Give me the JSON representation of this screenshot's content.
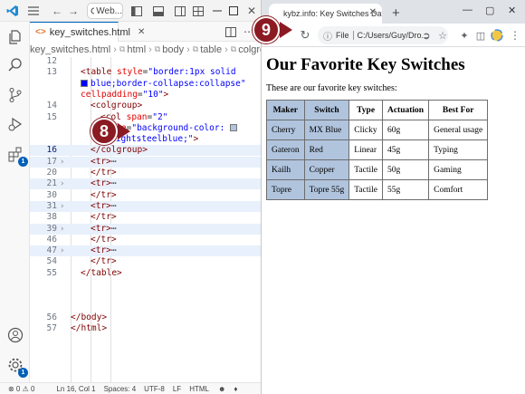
{
  "vscode": {
    "search_text": "Web...",
    "tab_filename": "key_switches.html",
    "breadcrumb": [
      "key_switches.html",
      "html",
      "body",
      "table",
      "colgroup"
    ],
    "lines": [
      {
        "num": "12",
        "parts": []
      },
      {
        "num": "13",
        "parts": [
          {
            "c": "tg",
            "t": "<table "
          },
          {
            "c": "at",
            "t": "style"
          },
          {
            "c": "pl",
            "t": "="
          },
          {
            "c": "vl",
            "t": "\"border:1px solid"
          }
        ]
      },
      {
        "num": "",
        "parts": [
          {
            "c": "vl",
            "t": "blue;border-collapse:collapse\""
          }
        ],
        "swatch": "#0000ff"
      },
      {
        "num": "",
        "parts": [
          {
            "c": "at",
            "t": "cellpadding"
          },
          {
            "c": "pl",
            "t": "="
          },
          {
            "c": "vl",
            "t": "\"10\""
          },
          {
            "c": "tg",
            "t": ">"
          }
        ]
      },
      {
        "num": "14",
        "parts": [
          {
            "c": "tg",
            "t": "<colgroup>"
          }
        ]
      },
      {
        "num": "15",
        "parts": [
          {
            "c": "tg",
            "t": "<col "
          },
          {
            "c": "at",
            "t": "span"
          },
          {
            "c": "pl",
            "t": "="
          },
          {
            "c": "vl",
            "t": "\"2\""
          }
        ]
      },
      {
        "num": "",
        "parts": [
          {
            "c": "at",
            "t": "style"
          },
          {
            "c": "pl",
            "t": "="
          },
          {
            "c": "vl",
            "t": "\"background-color:"
          }
        ],
        "swatch_end": "#b0c4de"
      },
      {
        "num": "",
        "parts": [
          {
            "c": "vl",
            "t": "lightsteelblue;\""
          },
          {
            "c": "tg",
            "t": ">"
          }
        ],
        "swatch": "#b0c4de"
      },
      {
        "num": "16",
        "parts": [
          {
            "c": "tg",
            "t": "</colgroup>"
          }
        ]
      },
      {
        "num": "17",
        "parts": [
          {
            "c": "tg",
            "t": "<tr>"
          },
          {
            "c": "pl",
            "t": "⋯"
          }
        ]
      },
      {
        "num": "20",
        "parts": [
          {
            "c": "tg",
            "t": "</tr>"
          }
        ]
      },
      {
        "num": "21",
        "parts": [
          {
            "c": "tg",
            "t": "<tr>"
          },
          {
            "c": "pl",
            "t": "⋯"
          }
        ]
      },
      {
        "num": "30",
        "parts": [
          {
            "c": "tg",
            "t": "</tr>"
          }
        ]
      },
      {
        "num": "31",
        "parts": [
          {
            "c": "tg",
            "t": "<tr>"
          },
          {
            "c": "pl",
            "t": "⋯"
          }
        ]
      },
      {
        "num": "38",
        "parts": [
          {
            "c": "tg",
            "t": "</tr>"
          }
        ]
      },
      {
        "num": "39",
        "parts": [
          {
            "c": "tg",
            "t": "<tr>"
          },
          {
            "c": "pl",
            "t": "⋯"
          }
        ]
      },
      {
        "num": "46",
        "parts": [
          {
            "c": "tg",
            "t": "</tr>"
          }
        ]
      },
      {
        "num": "47",
        "parts": [
          {
            "c": "tg",
            "t": "<tr>"
          },
          {
            "c": "pl",
            "t": "⋯"
          }
        ]
      },
      {
        "num": "54",
        "parts": [
          {
            "c": "tg",
            "t": "</tr>"
          }
        ]
      },
      {
        "num": "55",
        "parts": [
          {
            "c": "tg",
            "t": "</table>"
          }
        ]
      },
      {
        "num": "",
        "parts": []
      },
      {
        "num": "",
        "parts": []
      },
      {
        "num": "",
        "parts": []
      },
      {
        "num": "56",
        "parts": [
          {
            "c": "tg",
            "t": "</body>"
          }
        ]
      },
      {
        "num": "57",
        "parts": [
          {
            "c": "tg",
            "t": "</html>"
          }
        ]
      }
    ],
    "status": {
      "problems": "⊗ 0 ⚠ 0",
      "position": "Ln 16, Col 1",
      "spaces": "Spaces: 4",
      "encoding": "UTF-8",
      "eol": "LF",
      "language": "HTML"
    },
    "badge_count": "1",
    "accounts_badge": "1"
  },
  "chrome": {
    "tab_title": "kybz.info: Key Switches Data",
    "url_prefix": "File",
    "url": "C:/Users/Guy/Dro...",
    "page": {
      "heading": "Our Favorite Key Switches",
      "intro": "These are our favorite key switches:",
      "table": {
        "headers": [
          "Maker",
          "Switch",
          "Type",
          "Actuation",
          "Best For"
        ],
        "rows": [
          [
            "Cherry",
            "MX Blue",
            "Clicky",
            "60g",
            "General usage"
          ],
          [
            "Gateron",
            "Red",
            "Linear",
            "45g",
            "Typing"
          ],
          [
            "Kailh",
            "Copper",
            "Tactile",
            "50g",
            "Gaming"
          ],
          [
            "Topre",
            "Topre 55g",
            "Tactile",
            "55g",
            "Comfort"
          ]
        ]
      }
    }
  },
  "callouts": {
    "step8": "8",
    "step9": "9"
  },
  "colors": {
    "callout": "#8b1a23",
    "vscode_accent": "#005fb8",
    "col_bg": "#b0c4de",
    "table_border": "#0000ff"
  }
}
